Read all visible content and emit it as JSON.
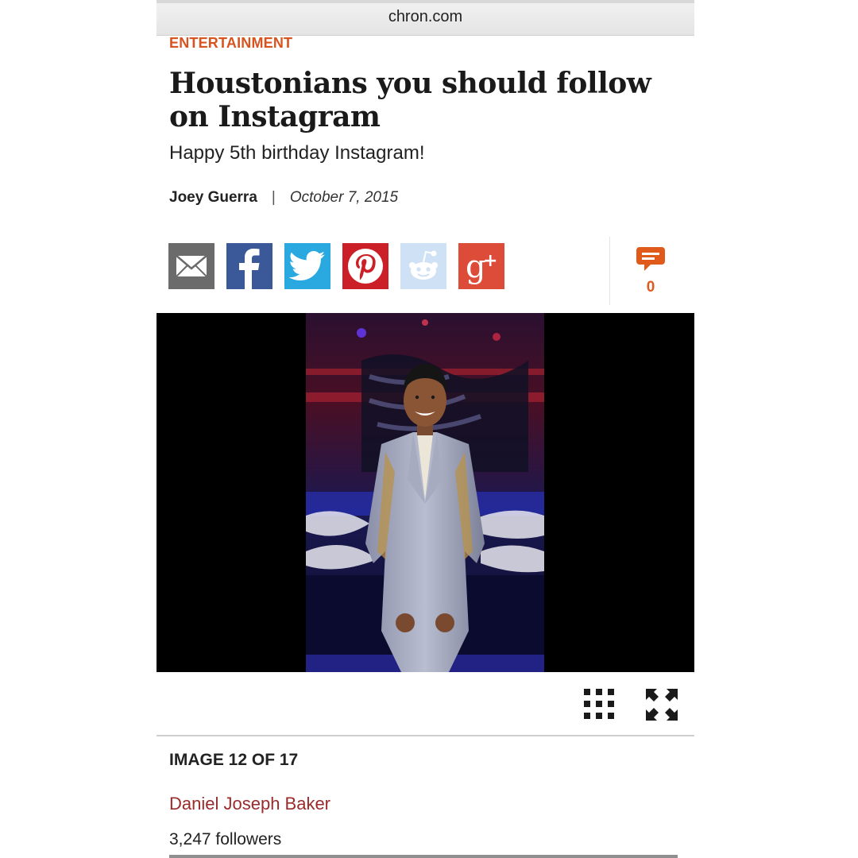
{
  "browser": {
    "url": "chron.com"
  },
  "article": {
    "category": "ENTERTAINMENT",
    "headline": "Houstonians you should follow on Instagram",
    "subhead": "Happy 5th birthday Instagram!",
    "author": "Joey Guerra",
    "separator": "|",
    "date": "October 7, 2015"
  },
  "share": {
    "buttons": [
      {
        "icon": "email-icon",
        "color": "#6b6b6b"
      },
      {
        "icon": "facebook-icon",
        "color": "#3b5998"
      },
      {
        "icon": "twitter-icon",
        "color": "#2aa9e0"
      },
      {
        "icon": "pinterest-icon",
        "color": "#cb2027"
      },
      {
        "icon": "reddit-icon",
        "color": "#cfe1f4"
      },
      {
        "icon": "google-plus-icon",
        "color": "#dd4b39"
      }
    ],
    "comment_count": "0"
  },
  "gallery": {
    "counter": "IMAGE 12 OF 17",
    "person_name": "Daniel Joseph Baker",
    "followers": "3,247 followers"
  },
  "colors": {
    "accent": "#d9531e",
    "link": "#9a2b2b"
  }
}
